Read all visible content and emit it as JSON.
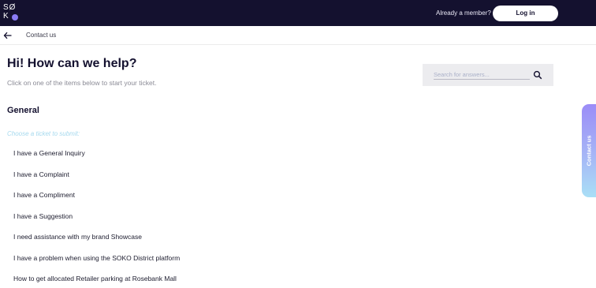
{
  "header": {
    "logo_text": "SØ KO",
    "member_prompt": "Already a member?",
    "login_label": "Log in"
  },
  "subnav": {
    "breadcrumb": "Contact us"
  },
  "main": {
    "heading": "Hi! How can we help?",
    "subheading": "Click on one of the items below to start your ticket.",
    "search_placeholder": "Search for answers...",
    "section_title": "General",
    "choose_label": "Choose a ticket to submit:",
    "tickets": [
      "I have a General Inquiry",
      "I have a Complaint",
      "I have a Compliment",
      "I have a Suggestion",
      "I need assistance with my brand Showcase",
      "I have a problem when using the SOKO District platform",
      "How to get allocated Retailer parking at Rosebank Mall"
    ]
  },
  "side_tab": {
    "label": "Contact us"
  },
  "colors": {
    "header_bg": "#14112f",
    "accent_purple": "#8b7cf6",
    "hint_blue": "#a5d9ee"
  }
}
